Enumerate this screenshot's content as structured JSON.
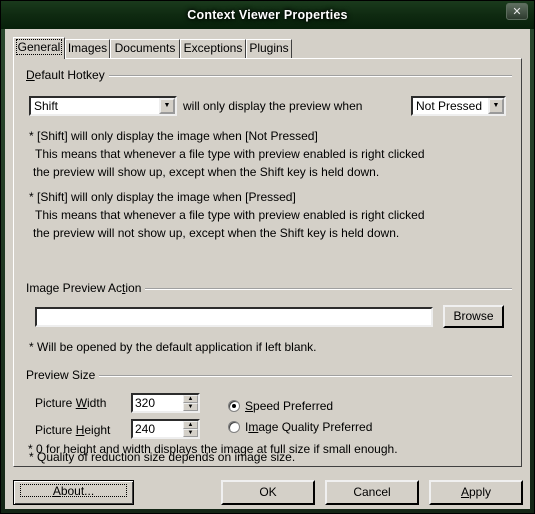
{
  "window": {
    "title": "Context Viewer Properties",
    "close_glyph": "✕"
  },
  "tabs": [
    {
      "label": "General",
      "active": true
    },
    {
      "label": "Images"
    },
    {
      "label": "Documents"
    },
    {
      "label": "Exceptions"
    },
    {
      "label": "Plugins"
    }
  ],
  "hotkey": {
    "group_label": "Default Hotkey",
    "key_value": "Shift",
    "middle_text": "will only display the preview when",
    "state_value": "Not Pressed",
    "note1": [
      "* [Shift] will only display the image when [Not Pressed]",
      "This means that whenever a file type with preview enabled is right clicked",
      "the preview will show up, except when the Shift key is held down."
    ],
    "note2": [
      "* [Shift] will only display the image when [Pressed]",
      "This means that whenever a file type with preview enabled is right clicked",
      "the preview will not show up, except when the Shift key is held down."
    ]
  },
  "preview_action": {
    "group_label": "Image Preview Action",
    "input_value": "",
    "browse_label": "Browse",
    "note": "* Will be opened by the default application if left blank."
  },
  "preview_size": {
    "group_label": "Preview Size",
    "width_label": "Picture Width",
    "width_value": "320",
    "height_label": "Picture Height",
    "height_value": "240",
    "radio_speed": "Speed Preferred",
    "radio_quality": "Image Quality Preferred",
    "selected": "speed",
    "note1": "* Quality of reduction size depends on image size.",
    "note2": "* 0 for height and width displays the image at full size if small enough."
  },
  "buttons": {
    "about": "About...",
    "ok": "OK",
    "cancel": "Cancel",
    "apply": "Apply"
  }
}
